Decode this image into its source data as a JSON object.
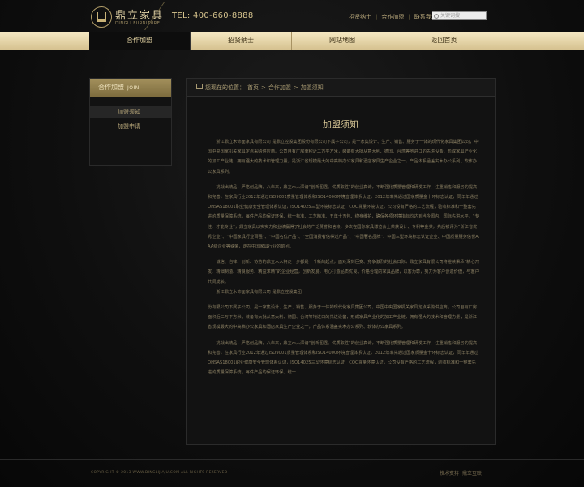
{
  "brand": {
    "name_cn": "鼎立家具",
    "name_en": "DINGLI FURNITURE"
  },
  "header": {
    "tel": "TEL: 400-660-8888",
    "links": [
      "招贤纳士",
      "合作加盟",
      "联系我们"
    ],
    "search_placeholder": "关键词搜"
  },
  "nav": {
    "items": [
      "合作加盟",
      "招贤纳士",
      "网站地图",
      "返回首页"
    ],
    "active_index": 0
  },
  "sidebar": {
    "title": "合作加盟",
    "title_en": "JOIN",
    "items": [
      "加盟须知",
      "加盟申请"
    ]
  },
  "breadcrumb": {
    "prefix": "您现在的位置：",
    "items": [
      "首页",
      "合作加盟",
      "加盟须知"
    ],
    "separator": ">"
  },
  "content": {
    "title": "加盟须知",
    "paragraphs": [
      "浙江鼎立木饰面家具有限公司 是鼎立控股集团股份有限公司下属子公司，是一家集设计、生产、销售、服务于一体的现代化家具集团公司，中国中央国家机关家具定点采购供应商。公司自有厂房面积近二万平方米，装备有大批从意大利、德国、台湾等地进口的先进设备，形成家具产业化的加工产业链，拥有强大的技术和管理力量，是浙江省规模最大的中高档办公家具和酒店家具生产企业之一，产品体系涵盖实木办公系列、软体办公家具系列。",
      "挑战出精品，严格创品牌，八年来，鼎立木人深谙“创新图强、优质取胜”的创业真谛，不断强化质量管理和研发工作，注重销售和服务的提高和完善，在家具行业2012年通过ISO9001质量管理体系和ISO14000环境管理体系认证，2012年率先通过国家质量金十环标志认证，同年年通过OHSAS18001职业健康安全管理体系认证，ISO14025三型环境标志认证，CQC質量环境认证，公司设有严格的工艺流程，验收标准和一整套先进的质量保障系统，每件产品均保证环保、统一标准、工艺精准、五年十五包、终身维护，确保各项环境指标均达到当今国内、国际先进水平，“专注、才能专业”，鼎立家具以实实力和业绩赢得了社会的广泛赞誉和信赖，多次在国际家具博览会上荣获设计、专利等金奖，先后被评为“浙江省优秀企业”、“中国家具行业百强”、“中国名优产品”、“全国消费者信得过产品”、“中国著名品牌”、中国三型环境标志认证企业、中国质量服务信誉AAA级企业等殊荣，走在中国家具行业的前列。",
      "诚信、自律、创新、协劳的鼎立木人将走一步都是一个新的起点，面对深刻巨变、竞争激烈的社会日际，鼎立家具有限公司将继续秉承“精心开发、精细制造、精良服务、精益求精”的企业经营，创新发展，用心打造品质优良、价格合理的家具品牌，以客为尊，努力为客户创造价值，与客户共同成长。",
      "浙江鼎立木饰面家具有限公司 是鼎立控股集团",
      "份有限公司下属子公司，是一家集设计、生产、销售、服务于一体的现代化家具集团公司，中国中央国家机关家具定点采购供应商。公司自有厂房面积近二万平方米，装备有大批从意大利、德国、台湾等地进口的先进设备，形成家具产业化的加工产业链，拥有强大的技术和管理力量，是浙江省规模最大的中高档办公家具和酒店家具生产企业之一，产品体系涵盖实木办公系列、软体办公家具系列。",
      "挑战出精品，严格创品牌，八年来，鼎立木人深谙“创新图强、优质取胜”的创业真谛，不断强化质量管理和研发工作，注重销售和服务的提高和完善，在家具行业2012年通过ISO9001质量管理体系和ISO14000环境管理体系认证，2012年率先通过国家质量金十环标志认证，同年年通过OHSAS18001职业健康安全管理体系认证，ISO14025三型环境标志认证，CQC質量环境认证，公司设有严格的工艺流程，验收标准和一整套先进的质量保障系统，每件产品均保证环保、统一"
    ]
  },
  "footer": {
    "copyright": "COPYRIGHT © 2013 WWW.DINGLIJIAJU.COM ALL RIGHTS RESERVED",
    "links": [
      "技术支持",
      "鼎立互联"
    ]
  }
}
